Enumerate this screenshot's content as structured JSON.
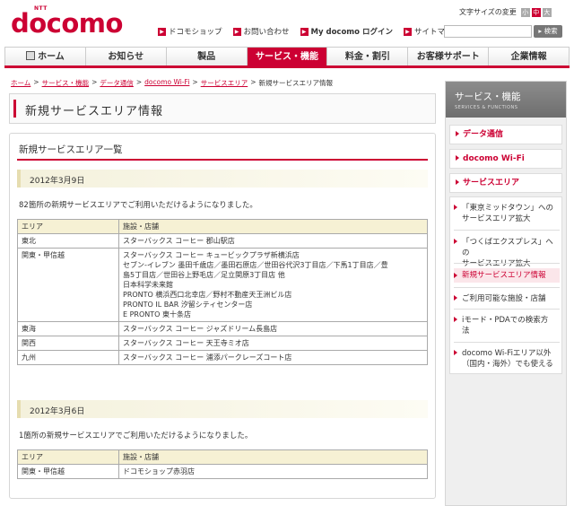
{
  "header": {
    "ntt_label": "NTT",
    "logo_text": "docomo",
    "top_links": [
      {
        "label": "ドコモショップ"
      },
      {
        "label": "お問い合わせ"
      },
      {
        "label": "My docomo ログイン"
      },
      {
        "label": "サイトマップ"
      }
    ],
    "font_size_label": "文字サイズの変更",
    "font_sizes": [
      "小",
      "中",
      "大"
    ],
    "font_size_active": "中",
    "search_button": "検索",
    "search_placeholder": ""
  },
  "global_nav": [
    {
      "label": "ホーム"
    },
    {
      "label": "お知らせ"
    },
    {
      "label": "製品"
    },
    {
      "label": "サービス・機能",
      "active": true
    },
    {
      "label": "料金・割引"
    },
    {
      "label": "お客様サポート"
    },
    {
      "label": "企業情報"
    }
  ],
  "breadcrumb": {
    "links": [
      "ホーム",
      "サービス・機能",
      "データ通信",
      "docomo Wi-Fi",
      "サービスエリア"
    ],
    "separator": ">",
    "current": "新規サービスエリア情報"
  },
  "page_title": "新規サービスエリア情報",
  "main": {
    "heading": "新規サービスエリア一覧",
    "sections": [
      {
        "date": "2012年3月9日",
        "intro": "82箇所の新規サービスエリアでご利用いただけるようになりました。",
        "headers": [
          "エリア",
          "施設・店舗"
        ],
        "rows": [
          {
            "area": "東北",
            "facilities": [
              "スターバックス コーヒー 郡山駅店"
            ]
          },
          {
            "area": "関東・甲信越",
            "facilities": [
              "スターバックス コーヒー キュービックプラザ新横浜店",
              "セブン-イレブン 墨田千歳店／墨田石原店／世田谷代沢3丁目店／下馬1丁目店／豊",
              "島5丁目店／世田谷上野毛店／足立関原3丁目店 他",
              "日本科学未来館",
              "PRONTO 横浜西口北幸店／野村不動産天王洲ビル店",
              "PRONTO IL BAR 汐留シティセンター店",
              "E PRONTO 東十条店"
            ]
          },
          {
            "area": "東海",
            "facilities": [
              "スターバックス コーヒー ジャズドリーム長島店"
            ]
          },
          {
            "area": "関西",
            "facilities": [
              "スターバックス コーヒー 天王寺ミオ店"
            ]
          },
          {
            "area": "九州",
            "facilities": [
              "スターバックス コーヒー 浦添パークレーズコート店"
            ]
          }
        ]
      },
      {
        "date": "2012年3月6日",
        "intro": "1箇所の新規サービスエリアでご利用いただけるようになりました。",
        "headers": [
          "エリア",
          "施設・店舗"
        ],
        "rows": [
          {
            "area": "関東・甲信越",
            "facilities": [
              "ドコモショップ赤羽店"
            ]
          }
        ]
      }
    ]
  },
  "sidebar": {
    "title": "サービス・機能",
    "subtitle": "SERVICES & FUNCTIONS",
    "categories": [
      "データ通信",
      "docomo Wi-Fi",
      "サービスエリア"
    ],
    "items": [
      {
        "label": "「東京ミッドタウン」へのサービスエリア拡大",
        "lines": [
          "「東京ミッドタウン」への",
          "サービスエリア拡大"
        ]
      },
      {
        "label": "「つくばエクスプレス」へのサービスエリア拡大",
        "lines": [
          "「つくばエクスプレス」への",
          "サービスエリア拡大"
        ]
      },
      {
        "label": "新規サービスエリア情報",
        "lines": [
          "新規サービスエリア情報"
        ],
        "active": true
      },
      {
        "label": "ご利用可能な施設・店舗",
        "lines": [
          "ご利用可能な施設・店舗"
        ]
      },
      {
        "label": "iモード・PDAでの検索方法",
        "lines": [
          "iモード・PDAでの検索方",
          "法"
        ]
      },
      {
        "label": "docomo Wi-Fiエリア以外（国内・海外）でも使える",
        "lines": [
          "docomo Wi-Fiエリア以外",
          "（国内・海外）でも使える"
        ]
      }
    ]
  },
  "colors": {
    "brand": "#cc0033",
    "header_bg": "#f6f1d4",
    "sidebar_bg": "#efefef"
  }
}
